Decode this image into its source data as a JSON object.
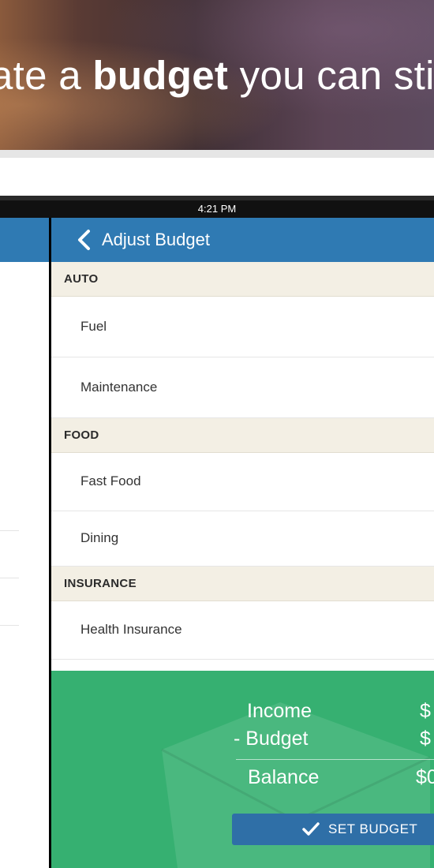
{
  "hero": {
    "text_pre": "ate a ",
    "text_bold": "budget",
    "text_post": " you can stic"
  },
  "statusbar": {
    "time": "4:21 PM"
  },
  "navbar": {
    "title": "Adjust Budget",
    "back_icon": "chevron-left-icon"
  },
  "sections": [
    {
      "label": "AUTO",
      "items": [
        "Fuel",
        "Maintenance"
      ]
    },
    {
      "label": "FOOD",
      "items": [
        "Fast Food",
        "Dining"
      ]
    },
    {
      "label": "INSURANCE",
      "items": [
        "Health Insurance"
      ]
    }
  ],
  "summary": {
    "income_label": "Income",
    "income_value": "$",
    "budget_label": "- Budget",
    "budget_value": "$",
    "balance_label": "Balance",
    "balance_value": "$0"
  },
  "set_budget": {
    "label": "SET BUDGET",
    "icon": "checkmark-icon"
  },
  "colors": {
    "nav_blue": "#2f7ab3",
    "section_bg": "#f3efe4",
    "footer_green": "#36b071",
    "button_blue": "#2f6fa7"
  }
}
